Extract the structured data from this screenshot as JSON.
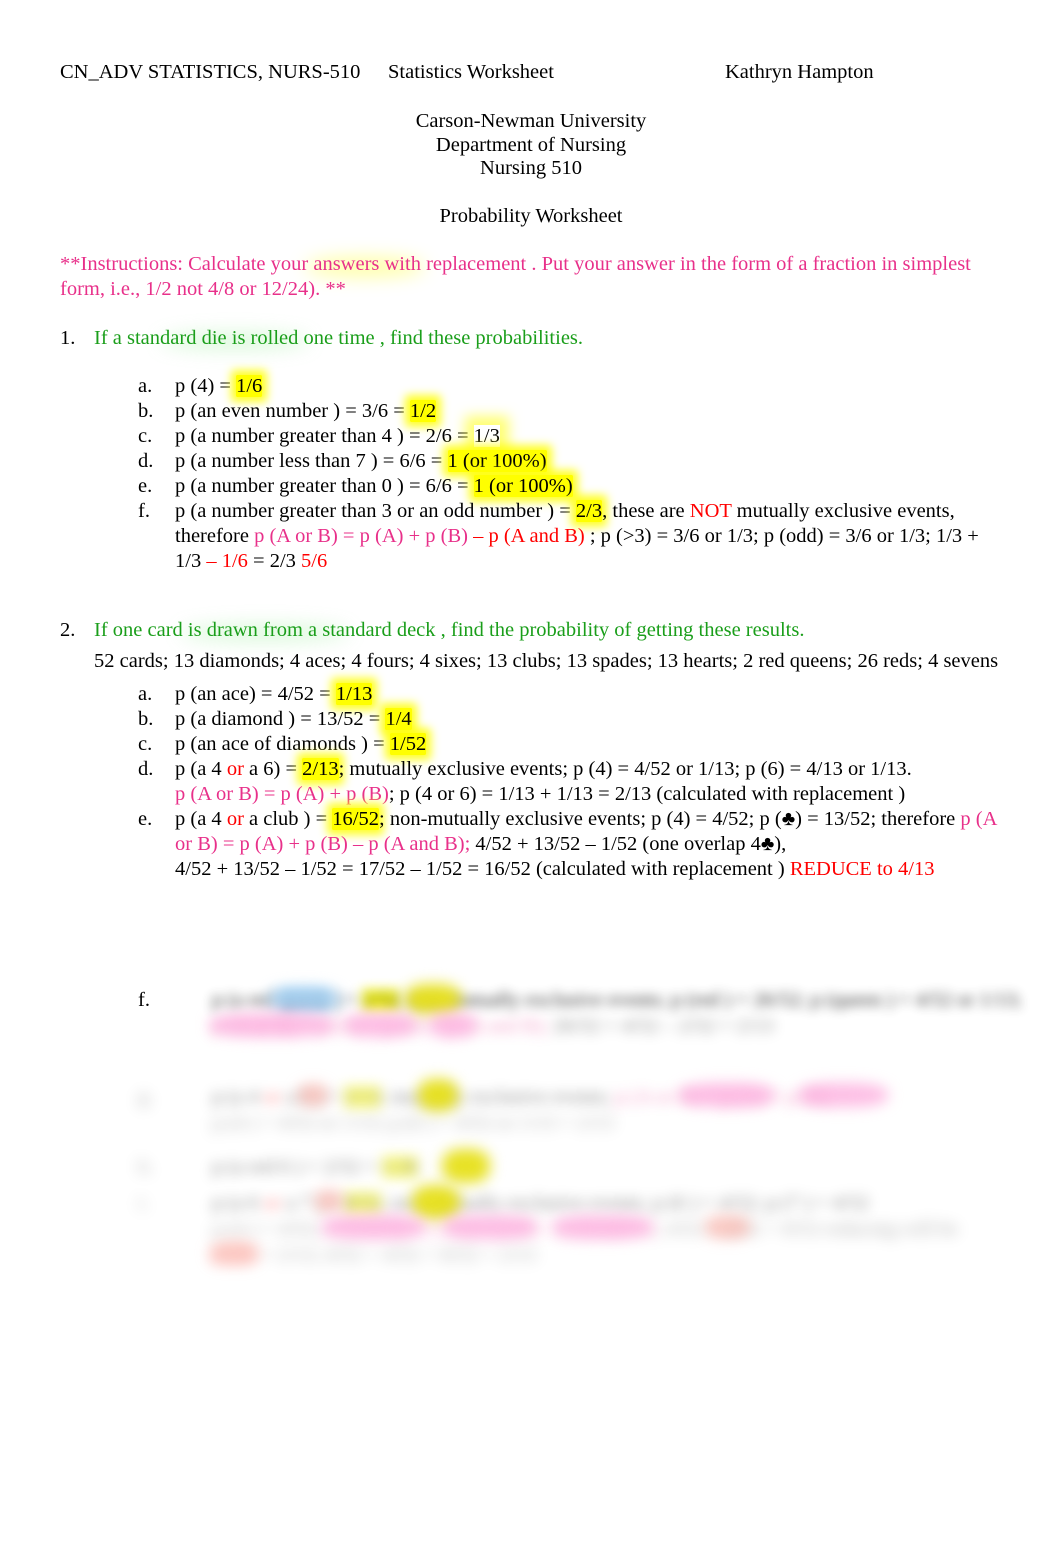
{
  "header": {
    "course": "CN_ADV STATISTICS, NURS-510",
    "doc_title": "Statistics Worksheet",
    "author": "Kathryn Hampton"
  },
  "title_block": {
    "line1": "Carson-Newman University",
    "line2": "Department of Nursing",
    "line3": "Nursing 510",
    "line4": "Probability Worksheet"
  },
  "instructions": {
    "text": "**Instructions:    Calculate your answers with replacement    .  Put your answer in the form of a fraction in simplest form, i.e., 1/2 not 4/8 or 12/24). **"
  },
  "colors": {
    "highlight": "#FFFF00",
    "pink": "#E8308A",
    "red": "#FF0000",
    "green": "#1A9E1A",
    "text": "#000000"
  },
  "question1": {
    "number": "1.",
    "prompt": "If a standard die is rolled one time   , find these probabilities.",
    "items": [
      {
        "marker": "a.",
        "lead": "p (4) = ",
        "answer": "1/6"
      },
      {
        "marker": "b.",
        "lead": "p (an even number ) = 3/6 = ",
        "answer": "1/2"
      },
      {
        "marker": "c.",
        "lead": "p (a number greater than 4  ) = 2/6 = ",
        "answer": "1/3"
      },
      {
        "marker": "d.",
        "lead": "p (a number less than 7 ) = 6/6 = ",
        "answer": "1 (or 100%)"
      },
      {
        "marker": "e.",
        "lead": "p (a number greater than 0  ) = 6/6 = ",
        "answer": "1 (or 100%)"
      },
      {
        "marker": "f.",
        "lead": "p (a number greater than 3 or    an odd number   ) = ",
        "answer": "2/3",
        "after_answer": ", these are ",
        "not_word": "NOT",
        "tail1": " mutually exclusive events,",
        "line2_prefix": "therefore ",
        "formula_pink": "p (A or B) = p (A) + p (B)",
        "formula_red": " – p (A and B)",
        "line2_tail": " ; p (>3) = 3/6 or 1/3; p (odd) = 3/6 or 1/3; 1/3 +",
        "line3_a": "1/3 ",
        "line3_red": "– 1/6",
        "line3_b": " = 2/3   ",
        "line3_red2": "5/6"
      }
    ]
  },
  "question2": {
    "number": "2.",
    "prompt": "If one card is drawn from a standard deck    , find the probability of getting these results.",
    "subtext": "52 cards; 13 diamonds; 4 aces; 4 fours; 4 sixes; 13 clubs; 13 spades; 13 hearts; 2 red queens; 26 reds; 4 sevens",
    "items": [
      {
        "marker": "a.",
        "lead": "p (an ace) = 4/52 = ",
        "answer": "1/13"
      },
      {
        "marker": "b.",
        "lead": "p (a diamond ) = 13/52 = ",
        "answer": "1/4"
      },
      {
        "marker": "c.",
        "lead": "p (an ace of diamonds ) = ",
        "answer": "1/52"
      },
      {
        "marker": "d.",
        "lead_a": "p (a 4 ",
        "or_word": "or",
        "lead_b": " a 6) = ",
        "answer": "2/13",
        "tail": "; mutually exclusive events; p (4) = 4/52 or 1/13; p (6) = 4/13 or 1/13.",
        "line2_pink": "p (A or B) = p (A) + p (B)",
        "line2_tail": "; p (4 or 6) = 1/13 + 1/13 = 2/13 (calculated with replacement  )"
      },
      {
        "marker": "e.",
        "lead_a": "p (a 4 ",
        "or_word": "or",
        "lead_b": " a club ) = ",
        "answer": "16/52",
        "tail": "; non-mutually exclusive events; p (4) = 4/52; p (♣) = 13/52; therefore ",
        "pink_wrap_1": "p (A",
        "pink_wrap_2": "or B) = p (A) + p (B) – p (A and B);",
        "line2_tail": "  4/52 + 13/52 – 1/52 (one overlap 4♣),",
        "line3": "4/52 + 13/52 – 1/52 = 17/52 – 1/52 = 16/52 (calculated with replacement  ) ",
        "line3_red": "REDUCE to 4/13"
      },
      {
        "marker": "f.",
        "redacted": true,
        "note": "content obscured"
      }
    ],
    "redacted_items": [
      {
        "marker": "g.",
        "redacted": true,
        "note": "content obscured"
      },
      {
        "marker": "h.",
        "redacted": true,
        "note": "content obscured"
      },
      {
        "marker": "i.",
        "redacted": true,
        "note": "content obscured"
      }
    ]
  }
}
